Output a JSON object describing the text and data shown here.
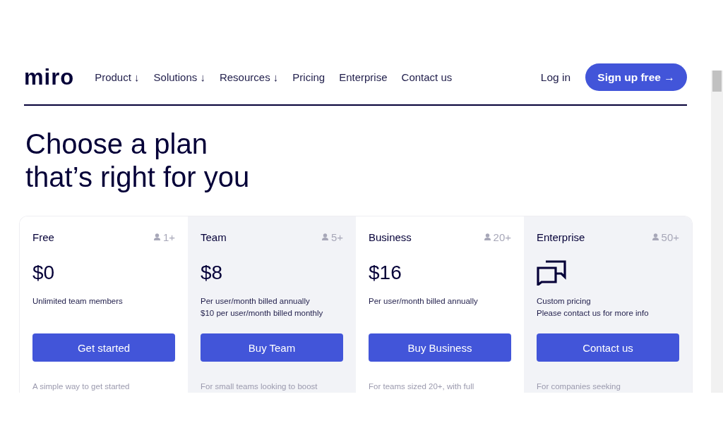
{
  "header": {
    "logo": "miro",
    "nav": [
      {
        "label": "Product ↓"
      },
      {
        "label": "Solutions ↓"
      },
      {
        "label": "Resources ↓"
      },
      {
        "label": "Pricing"
      },
      {
        "label": "Enterprise"
      },
      {
        "label": "Contact us"
      }
    ],
    "login": "Log in",
    "signup": "Sign up free →"
  },
  "heading": [
    "Choose a plan",
    "that’s right for you"
  ],
  "plans": [
    {
      "name": "Free",
      "seats": "1+",
      "kind": "price",
      "price": "$0",
      "details": [
        "Unlimited team members"
      ],
      "button": "Get started",
      "tagline": "A simple way to get started"
    },
    {
      "name": "Team",
      "seats": "5+",
      "kind": "price",
      "price": "$8",
      "details": [
        "Per user/month billed annually",
        "$10 per user/month billed monthly"
      ],
      "button": "Buy Team",
      "tagline": "For small teams looking to boost"
    },
    {
      "name": "Business",
      "seats": "20+",
      "kind": "price",
      "price": "$16",
      "details": [
        "Per user/month billed annually"
      ],
      "button": "Buy Business",
      "tagline": "For teams sized 20+, with full"
    },
    {
      "name": "Enterprise",
      "seats": "50+",
      "kind": "icon",
      "details": [
        "Custom pricing",
        "Please contact us for more info"
      ],
      "button": "Contact us",
      "tagline": "For companies seeking"
    }
  ]
}
